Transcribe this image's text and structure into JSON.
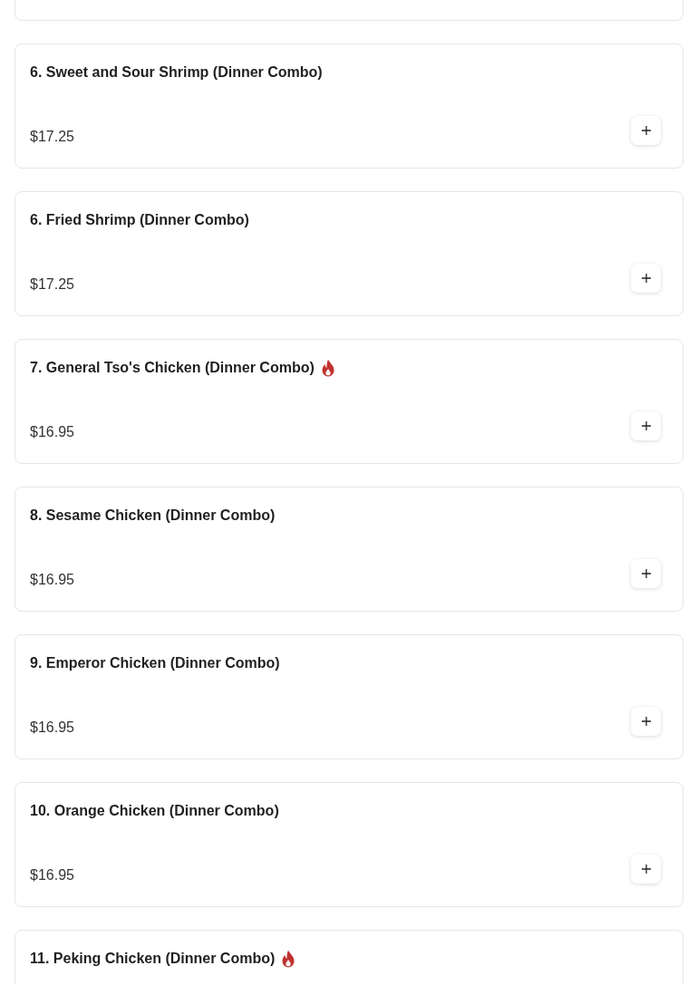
{
  "items": [
    {
      "title": "6. Sweet and Sour Shrimp (Dinner Combo)",
      "spicy": false,
      "price": "$17.25"
    },
    {
      "title": "6. Fried Shrimp (Dinner Combo)",
      "spicy": false,
      "price": "$17.25"
    },
    {
      "title": "7. General Tso's Chicken (Dinner Combo)",
      "spicy": true,
      "price": "$16.95"
    },
    {
      "title": "8. Sesame Chicken (Dinner Combo)",
      "spicy": false,
      "price": "$16.95"
    },
    {
      "title": "9. Emperor Chicken (Dinner Combo)",
      "spicy": false,
      "price": "$16.95"
    },
    {
      "title": "10. Orange Chicken (Dinner Combo)",
      "spicy": false,
      "price": "$16.95"
    },
    {
      "title": "11. Peking Chicken (Dinner Combo)",
      "spicy": true
    }
  ]
}
